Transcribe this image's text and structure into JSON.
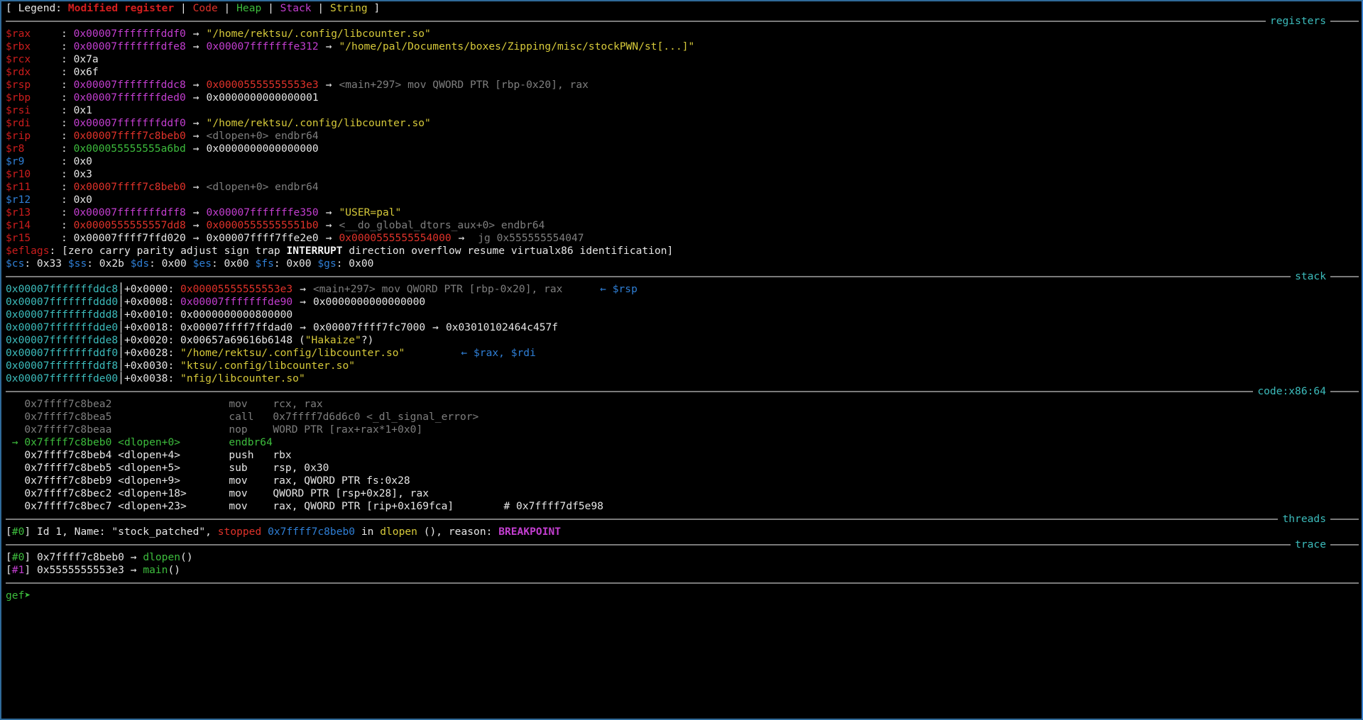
{
  "legend": {
    "open": "[ Legend: ",
    "items": [
      {
        "label": "Modified register",
        "color": "#d41f1f"
      },
      {
        "label": "Code",
        "color": "#e0322a"
      },
      {
        "label": "Heap",
        "color": "#3dbd3d"
      },
      {
        "label": "Stack",
        "color": "#c33ed0"
      },
      {
        "label": "String",
        "color": "#d6c93a"
      }
    ],
    "sep": " | ",
    "close": " ]"
  },
  "sections": {
    "registers": "registers",
    "stack": "stack",
    "code": "code:x86:64",
    "threads": "threads",
    "trace": "trace"
  },
  "arrow": "→",
  "left_arrow": "←",
  "registers": [
    {
      "name": "$rax",
      "modified": true,
      "chain": [
        {
          "v": "0x00007fffffffddf0",
          "c": "purple"
        },
        {
          "v": "\"/home/rektsu/.config/libcounter.so\"",
          "c": "yellow"
        }
      ]
    },
    {
      "name": "$rbx",
      "modified": true,
      "chain": [
        {
          "v": "0x00007fffffffdfe8",
          "c": "purple"
        },
        {
          "v": "0x00007fffffffe312",
          "c": "purple"
        },
        {
          "v": "\"/home/pal/Documents/boxes/Zipping/misc/stockPWN/st[...]\"",
          "c": "yellow"
        }
      ]
    },
    {
      "name": "$rcx",
      "modified": true,
      "chain": [
        {
          "v": "0x7a",
          "c": "white"
        }
      ]
    },
    {
      "name": "$rdx",
      "modified": true,
      "chain": [
        {
          "v": "0x6f",
          "c": "white"
        }
      ]
    },
    {
      "name": "$rsp",
      "modified": true,
      "chain": [
        {
          "v": "0x00007fffffffddc8",
          "c": "purple"
        },
        {
          "v": "0x00005555555553e3",
          "c": "red"
        },
        {
          "v": "<main+297> mov QWORD PTR [rbp-0x20], rax",
          "c": "gray"
        }
      ]
    },
    {
      "name": "$rbp",
      "modified": true,
      "chain": [
        {
          "v": "0x00007fffffffded0",
          "c": "purple"
        },
        {
          "v": "0x0000000000000001",
          "c": "white"
        }
      ]
    },
    {
      "name": "$rsi",
      "modified": true,
      "chain": [
        {
          "v": "0x1",
          "c": "white"
        }
      ]
    },
    {
      "name": "$rdi",
      "modified": true,
      "chain": [
        {
          "v": "0x00007fffffffddf0",
          "c": "purple"
        },
        {
          "v": "\"/home/rektsu/.config/libcounter.so\"",
          "c": "yellow"
        }
      ]
    },
    {
      "name": "$rip",
      "modified": true,
      "chain": [
        {
          "v": "0x00007ffff7c8beb0",
          "c": "red"
        },
        {
          "v": "<dlopen+0> endbr64",
          "c": "gray"
        }
      ]
    },
    {
      "name": "$r8",
      "modified": true,
      "chain": [
        {
          "v": "0x000055555555a6bd",
          "c": "green"
        },
        {
          "v": "0x0000000000000000",
          "c": "white"
        }
      ]
    },
    {
      "name": "$r9",
      "modified": false,
      "chain": [
        {
          "v": "0x0",
          "c": "white"
        }
      ]
    },
    {
      "name": "$r10",
      "modified": true,
      "chain": [
        {
          "v": "0x3",
          "c": "white"
        }
      ]
    },
    {
      "name": "$r11",
      "modified": true,
      "chain": [
        {
          "v": "0x00007ffff7c8beb0",
          "c": "red"
        },
        {
          "v": "<dlopen+0> endbr64",
          "c": "gray"
        }
      ]
    },
    {
      "name": "$r12",
      "modified": false,
      "chain": [
        {
          "v": "0x0",
          "c": "white"
        }
      ]
    },
    {
      "name": "$r13",
      "modified": true,
      "chain": [
        {
          "v": "0x00007fffffffdff8",
          "c": "purple"
        },
        {
          "v": "0x00007fffffffe350",
          "c": "purple"
        },
        {
          "v": "\"USER=pal\"",
          "c": "yellow"
        }
      ]
    },
    {
      "name": "$r14",
      "modified": true,
      "chain": [
        {
          "v": "0x0000555555557dd8",
          "c": "red"
        },
        {
          "v": "0x00005555555551b0",
          "c": "red"
        },
        {
          "v": "<__do_global_dtors_aux+0> endbr64",
          "c": "gray"
        }
      ]
    },
    {
      "name": "$r15",
      "modified": true,
      "chain": [
        {
          "v": "0x00007ffff7ffd020",
          "c": "white"
        },
        {
          "v": "0x00007ffff7ffe2e0",
          "c": "white"
        },
        {
          "v": "0x0000555555554000",
          "c": "red"
        },
        {
          "v": " jg 0x555555554047",
          "c": "gray"
        }
      ]
    }
  ],
  "eflags": {
    "name": "$eflags",
    "open": "[",
    "flags": [
      {
        "f": "zero",
        "set": false
      },
      {
        "f": "carry",
        "set": false
      },
      {
        "f": "parity",
        "set": false
      },
      {
        "f": "adjust",
        "set": false
      },
      {
        "f": "sign",
        "set": false
      },
      {
        "f": "trap",
        "set": false
      },
      {
        "f": "INTERRUPT",
        "set": true
      },
      {
        "f": "direction",
        "set": false
      },
      {
        "f": "overflow",
        "set": false
      },
      {
        "f": "resume",
        "set": false
      },
      {
        "f": "virtualx86",
        "set": false
      },
      {
        "f": "identification",
        "set": false
      }
    ],
    "close": "]"
  },
  "segments": [
    {
      "name": "$cs",
      "value": "0x33"
    },
    {
      "name": "$ss",
      "value": "0x2b"
    },
    {
      "name": "$ds",
      "value": "0x00"
    },
    {
      "name": "$es",
      "value": "0x00"
    },
    {
      "name": "$fs",
      "value": "0x00"
    },
    {
      "name": "$gs",
      "value": "0x00"
    }
  ],
  "stack": [
    {
      "addr": "0x00007fffffffddc8",
      "offset": "+0x0000:",
      "chain": [
        {
          "v": "0x00005555555553e3",
          "c": "red"
        },
        {
          "v": "<main+297> mov QWORD PTR [rbp-0x20], rax",
          "c": "gray"
        }
      ],
      "note": "← $rsp"
    },
    {
      "addr": "0x00007fffffffddd0",
      "offset": "+0x0008:",
      "chain": [
        {
          "v": "0x00007fffffffde90",
          "c": "purple"
        },
        {
          "v": "0x0000000000000000",
          "c": "white"
        }
      ],
      "note": ""
    },
    {
      "addr": "0x00007fffffffddd8",
      "offset": "+0x0010:",
      "chain": [
        {
          "v": "0x0000000000800000",
          "c": "white"
        }
      ],
      "note": ""
    },
    {
      "addr": "0x00007fffffffdde0",
      "offset": "+0x0018:",
      "chain": [
        {
          "v": "0x00007ffff7ffdad0",
          "c": "white"
        },
        {
          "v": "0x00007ffff7fc7000",
          "c": "white"
        },
        {
          "v": "0x03010102464c457f",
          "c": "white"
        }
      ],
      "note": ""
    },
    {
      "addr": "0x00007fffffffdde8",
      "offset": "+0x0020:",
      "raw": "0x00657a69616b6148 (",
      "rawstr": "\"Hakaize\"",
      "rawtail": "?)",
      "note": ""
    },
    {
      "addr": "0x00007fffffffddf0",
      "offset": "+0x0028:",
      "chain": [
        {
          "v": "\"/home/rektsu/.config/libcounter.so\"",
          "c": "yellow"
        }
      ],
      "note": "← $rax, $rdi"
    },
    {
      "addr": "0x00007fffffffddf8",
      "offset": "+0x0030:",
      "chain": [
        {
          "v": "\"ktsu/.config/libcounter.so\"",
          "c": "yellow"
        }
      ],
      "note": ""
    },
    {
      "addr": "0x00007fffffffde00",
      "offset": "+0x0038:",
      "chain": [
        {
          "v": "\"nfig/libcounter.so\"",
          "c": "yellow"
        }
      ],
      "note": ""
    }
  ],
  "code": [
    {
      "current": false,
      "past": true,
      "addr": "0x7ffff7c8bea2",
      "sym": "",
      "op": "mov",
      "args": "rcx, rax",
      "comment": ""
    },
    {
      "current": false,
      "past": true,
      "addr": "0x7ffff7c8bea5",
      "sym": "",
      "op": "call",
      "args": "0x7ffff7d6d6c0 <_dl_signal_error>",
      "comment": ""
    },
    {
      "current": false,
      "past": true,
      "addr": "0x7ffff7c8beaa",
      "sym": "",
      "op": "nop",
      "args": "WORD PTR [rax+rax*1+0x0]",
      "comment": ""
    },
    {
      "current": true,
      "past": false,
      "addr": "0x7ffff7c8beb0",
      "sym": "<dlopen+0>",
      "op": "endbr64",
      "args": "",
      "comment": ""
    },
    {
      "current": false,
      "past": false,
      "addr": "0x7ffff7c8beb4",
      "sym": "<dlopen+4>",
      "op": "push",
      "args": "rbx",
      "comment": ""
    },
    {
      "current": false,
      "past": false,
      "addr": "0x7ffff7c8beb5",
      "sym": "<dlopen+5>",
      "op": "sub",
      "args": "rsp, 0x30",
      "comment": ""
    },
    {
      "current": false,
      "past": false,
      "addr": "0x7ffff7c8beb9",
      "sym": "<dlopen+9>",
      "op": "mov",
      "args": "rax, QWORD PTR fs:0x28",
      "comment": ""
    },
    {
      "current": false,
      "past": false,
      "addr": "0x7ffff7c8bec2",
      "sym": "<dlopen+18>",
      "op": "mov",
      "args": "QWORD PTR [rsp+0x28], rax",
      "comment": ""
    },
    {
      "current": false,
      "past": false,
      "addr": "0x7ffff7c8bec7",
      "sym": "<dlopen+23>",
      "op": "mov",
      "args": "rax, QWORD PTR [rip+0x169fca]",
      "comment": "# 0x7ffff7df5e98"
    }
  ],
  "threads": [
    {
      "idx": "#0",
      "text1": " Id 1, Name: \"stock_patched\", ",
      "state": "stopped",
      "addr": "0x7ffff7c8beb0",
      "in": " in ",
      "func": "dlopen",
      "text2": " (), reason: ",
      "reason": "BREAKPOINT"
    }
  ],
  "trace": [
    {
      "idx": "#0",
      "idx_color": "green",
      "addr": "0x7ffff7c8beb0",
      "func": "dlopen",
      "parens": "()"
    },
    {
      "idx": "#1",
      "idx_color": "purple",
      "addr": "0x5555555553e3",
      "func": "main",
      "parens": "()"
    }
  ],
  "prompt": "gef➤ "
}
